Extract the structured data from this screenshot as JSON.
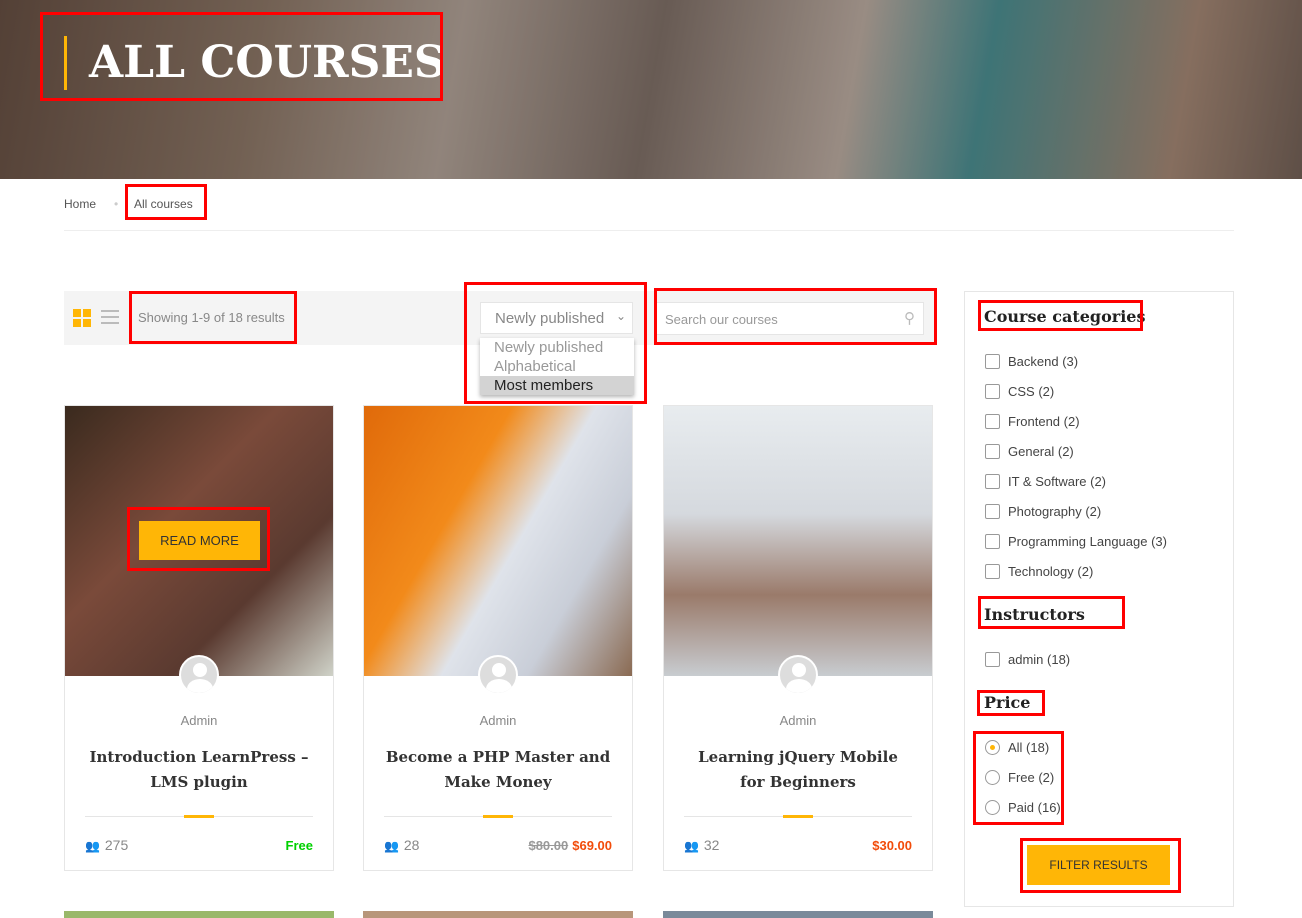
{
  "hero": {
    "title": "ALL COURSES"
  },
  "breadcrumb": {
    "home": "Home",
    "current": "All courses"
  },
  "toolbar": {
    "result_count": "Showing 1-9 of 18 results",
    "sort_selected": "Newly published",
    "sort_options": [
      "Newly published",
      "Alphabetical",
      "Most members"
    ],
    "search_placeholder": "Search our courses"
  },
  "courses": [
    {
      "author": "Admin",
      "title": "Introduction LearnPress – LMS plugin",
      "students": "275",
      "price": "Free",
      "old_price": "",
      "price_color": "#00d100",
      "hover_button": "READ MORE"
    },
    {
      "author": "Admin",
      "title": "Become a PHP Master and Make Money",
      "students": "28",
      "price": "$69.00",
      "old_price": "$80.00",
      "price_color": "#f24c0a"
    },
    {
      "author": "Admin",
      "title": "Learning jQuery Mobile for Beginners",
      "students": "32",
      "price": "$30.00",
      "old_price": "",
      "price_color": "#f24c0a"
    }
  ],
  "sidebar": {
    "categories_title": "Course categories",
    "categories": [
      "Backend (3)",
      "CSS (2)",
      "Frontend (2)",
      "General (2)",
      "IT & Software (2)",
      "Photography (2)",
      "Programming Language (3)",
      "Technology (2)"
    ],
    "instructors_title": "Instructors",
    "instructors": [
      "admin (18)"
    ],
    "price_title": "Price",
    "price_options": [
      "All (18)",
      "Free (2)",
      "Paid (16)"
    ],
    "price_selected": "All (18)",
    "filter_button": "FILTER RESULTS"
  },
  "colors": {
    "accent": "#ffb606",
    "annotation": "#ff0000"
  }
}
